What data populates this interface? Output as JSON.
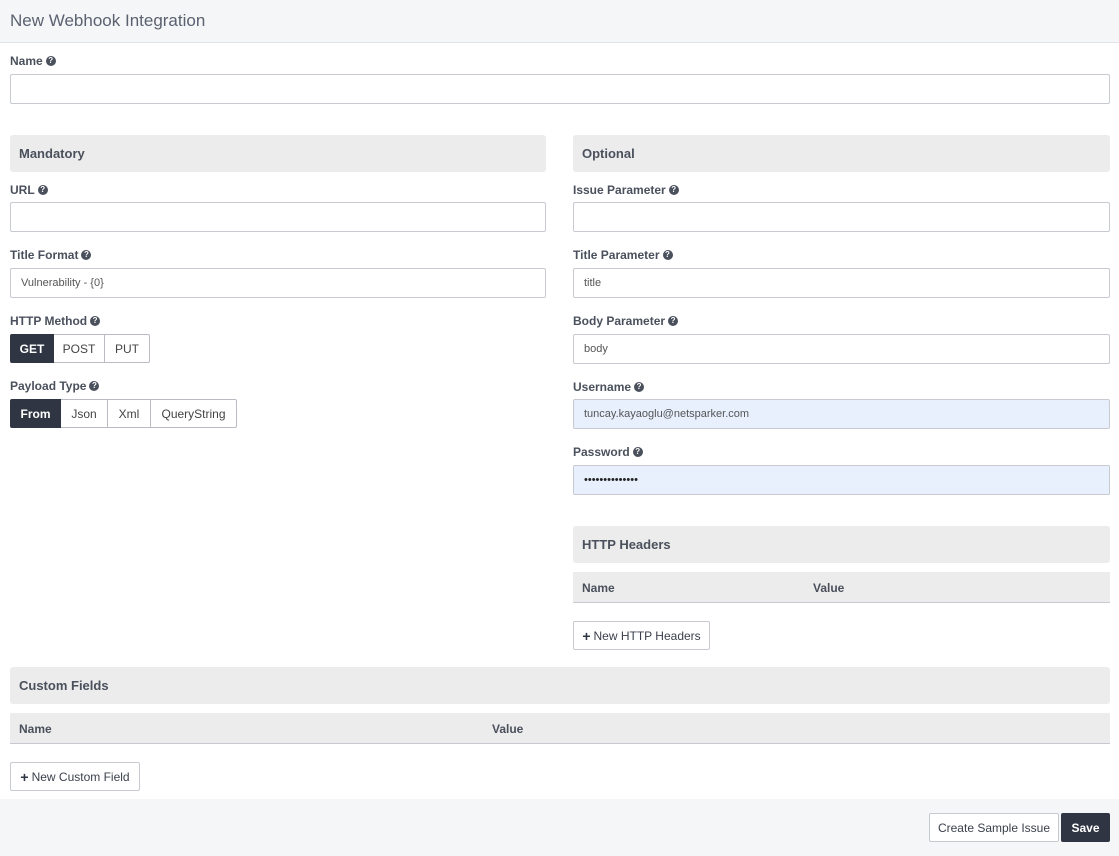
{
  "header": {
    "title": "New Webhook Integration"
  },
  "name_field": {
    "label": "Name",
    "value": ""
  },
  "mandatory": {
    "title": "Mandatory",
    "url": {
      "label": "URL",
      "value": ""
    },
    "title_format": {
      "label": "Title Format",
      "value": "Vulnerability - {0}"
    },
    "http_method": {
      "label": "HTTP Method",
      "options": [
        "GET",
        "POST",
        "PUT"
      ],
      "selected": "GET"
    },
    "payload_type": {
      "label": "Payload Type",
      "options": [
        "From",
        "Json",
        "Xml",
        "QueryString"
      ],
      "selected": "From"
    }
  },
  "optional": {
    "title": "Optional",
    "issue_parameter": {
      "label": "Issue Parameter",
      "value": ""
    },
    "title_parameter": {
      "label": "Title Parameter",
      "value": "title"
    },
    "body_parameter": {
      "label": "Body Parameter",
      "value": "body"
    },
    "username": {
      "label": "Username",
      "value": "tuncay.kayaoglu@netsparker.com"
    },
    "password": {
      "label": "Password",
      "value": "••••••••••••••"
    }
  },
  "http_headers": {
    "title": "HTTP Headers",
    "columns": [
      "Name",
      "Value"
    ],
    "add_label": "New HTTP Headers"
  },
  "custom_fields": {
    "title": "Custom Fields",
    "columns": [
      "Name",
      "Value"
    ],
    "add_label": "New Custom Field"
  },
  "footer": {
    "create_sample_label": "Create Sample Issue",
    "save_label": "Save"
  },
  "icons": {
    "help": "question-circle-icon",
    "add": "plus-icon"
  },
  "colors": {
    "active_button": "#2f3542",
    "section_bg": "#ececec",
    "autofill_bg": "#e8f0fe"
  }
}
